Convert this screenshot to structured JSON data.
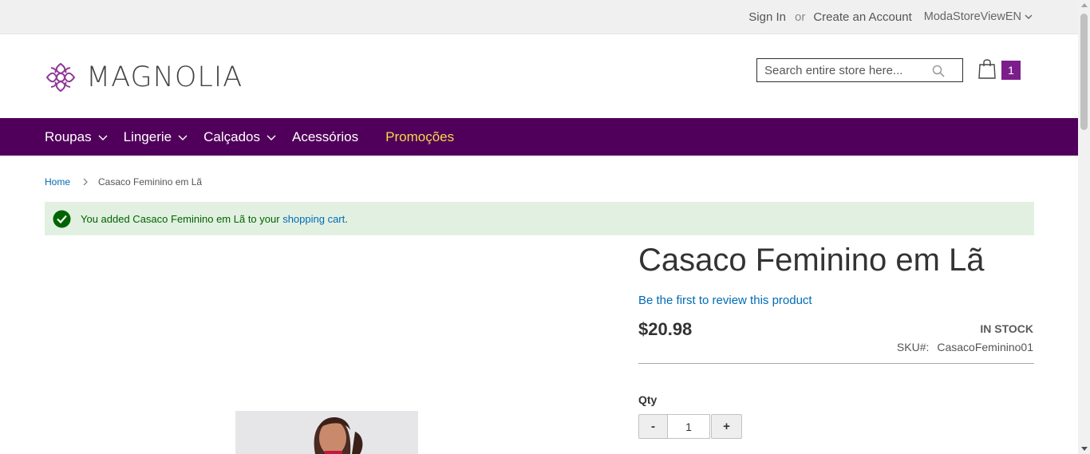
{
  "header": {
    "sign_in": "Sign In",
    "or": "or",
    "create_account": "Create an Account",
    "store_switcher": "ModaStoreViewEN"
  },
  "logo": {
    "text": "MAGNOLIA",
    "icon": "magnolia-flower-logo",
    "color": "#8e3a98"
  },
  "search": {
    "placeholder": "Search entire store here...",
    "value": ""
  },
  "cart": {
    "count": "1",
    "icon": "shopping-bag-icon"
  },
  "nav": {
    "items": [
      {
        "label": "Roupas",
        "has_dropdown": true
      },
      {
        "label": "Lingerie",
        "has_dropdown": true
      },
      {
        "label": "Calçados",
        "has_dropdown": true
      },
      {
        "label": "Acessórios",
        "has_dropdown": false
      },
      {
        "label": "Promoções",
        "has_dropdown": false
      }
    ],
    "background": "#50005a",
    "promo_color": "#f9d84a"
  },
  "breadcrumb": {
    "home": "Home",
    "current": "Casaco Feminino em Lã"
  },
  "message": {
    "text_before": "You added Casaco Feminino em Lã to your ",
    "link": "shopping cart",
    "text_after": "."
  },
  "product": {
    "title": "Casaco Feminino em Lã",
    "review_link": "Be the first to review this product",
    "price": "$20.98",
    "stock": "IN STOCK",
    "sku_label": "SKU#:",
    "sku": "CasacoFeminino01",
    "qty_label": "Qty",
    "qty": "1",
    "minus": "-",
    "plus": "+"
  }
}
